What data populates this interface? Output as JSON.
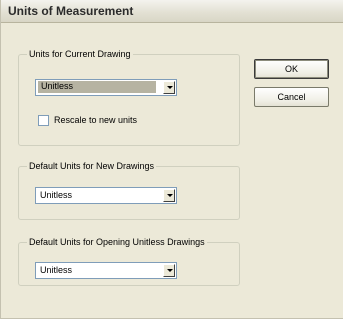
{
  "dialog": {
    "title": "Units of Measurement"
  },
  "current_drawing": {
    "legend": "Units for Current Drawing",
    "selected": "Unitless",
    "rescale_label": "Rescale to new units",
    "rescale_checked": false
  },
  "new_drawings": {
    "legend": "Default Units for New Drawings",
    "selected": "Unitless"
  },
  "opening_unitless": {
    "legend": "Default Units for Opening Unitless Drawings",
    "selected": "Unitless"
  },
  "buttons": {
    "ok_label": "OK",
    "cancel_label": "Cancel"
  },
  "icons": {
    "combo_arrow": "chevron-down-icon"
  }
}
